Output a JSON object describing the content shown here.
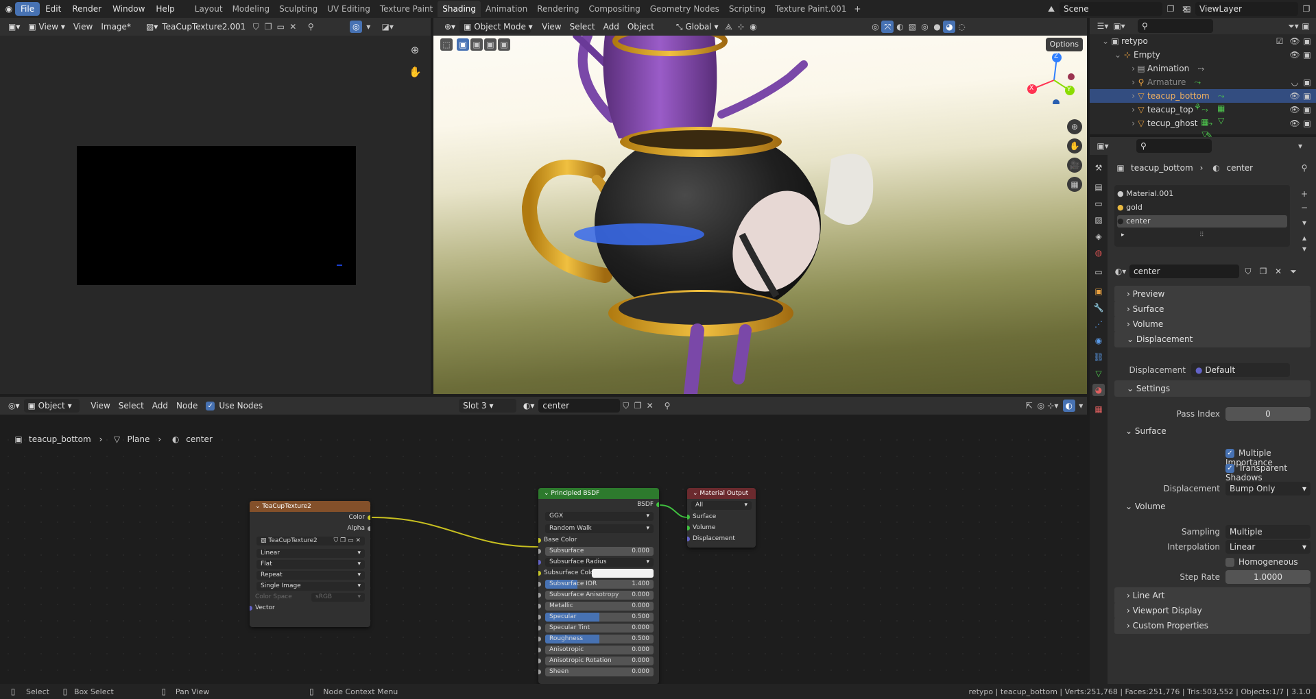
{
  "topbar": {
    "menus": [
      "File",
      "Edit",
      "Render",
      "Window",
      "Help"
    ],
    "workspaces": [
      "Layout",
      "Modeling",
      "Sculpting",
      "UV Editing",
      "Texture Paint",
      "Shading",
      "Animation",
      "Rendering",
      "Compositing",
      "Geometry Nodes",
      "Scripting",
      "Texture Paint.001"
    ],
    "active_workspace": "Shading",
    "scene": "Scene",
    "view_layer": "ViewLayer"
  },
  "image_editor": {
    "view": "View",
    "view2": "View",
    "image_menu": "Image*",
    "image_name": "TeaCupTexture2.001"
  },
  "viewport": {
    "mode": "Object Mode",
    "menus": [
      "View",
      "Select",
      "Add",
      "Object"
    ],
    "orientation": "Global",
    "options": "Options",
    "axes": {
      "x": "X",
      "y": "Y",
      "z": "Z"
    }
  },
  "node_header": {
    "editor": "Object",
    "menus": [
      "View",
      "Select",
      "Add",
      "Node"
    ],
    "use_nodes": "Use Nodes",
    "slot": "Slot 3",
    "material": "center"
  },
  "node_breadcrumb": {
    "object": "teacup_bottom",
    "mesh": "Plane",
    "material": "center"
  },
  "nodes": {
    "texture": {
      "title": "TeaCupTexture2",
      "out_color": "Color",
      "out_alpha": "Alpha",
      "image": "TeaCupTexture2",
      "interpolation": "Linear",
      "projection": "Flat",
      "extension": "Repeat",
      "source": "Single Image",
      "color_space_label": "Color Space",
      "color_space": "sRGB",
      "in_vector": "Vector"
    },
    "bsdf": {
      "title": "Principled BSDF",
      "out": "BSDF",
      "distribution": "GGX",
      "subsurface_method": "Random Walk",
      "base_color": "Base Color",
      "subsurface_radius": "Subsurface Radius",
      "subsurface_color": "Subsurface Colo",
      "rows": [
        {
          "label": "Subsurface",
          "value": "0.000",
          "fill": 0
        },
        {
          "label": "Subsurface IOR",
          "value": "1.400",
          "fill": 0.3
        },
        {
          "label": "Subsurface Anisotropy",
          "value": "0.000",
          "fill": 0
        },
        {
          "label": "Metallic",
          "value": "0.000",
          "fill": 0
        },
        {
          "label": "Specular",
          "value": "0.500",
          "fill": 0.5
        },
        {
          "label": "Specular Tint",
          "value": "0.000",
          "fill": 0
        },
        {
          "label": "Roughness",
          "value": "0.500",
          "fill": 0.5
        },
        {
          "label": "Anisotropic",
          "value": "0.000",
          "fill": 0
        },
        {
          "label": "Anisotropic Rotation",
          "value": "0.000",
          "fill": 0
        },
        {
          "label": "Sheen",
          "value": "0.000",
          "fill": 0
        }
      ]
    },
    "output": {
      "title": "Material Output",
      "target": "All",
      "surface": "Surface",
      "volume": "Volume",
      "displacement": "Displacement"
    }
  },
  "outliner": {
    "rows": [
      {
        "name": "retypo",
        "level": 0
      },
      {
        "name": "Empty",
        "level": 1
      },
      {
        "name": "Animation",
        "level": 2
      },
      {
        "name": "Armature",
        "level": 2
      },
      {
        "name": "teacup_bottom",
        "level": 2
      },
      {
        "name": "teacup_top",
        "level": 2
      },
      {
        "name": "tecup_ghost",
        "level": 2
      }
    ]
  },
  "properties": {
    "breadcrumb_object": "teacup_bottom",
    "breadcrumb_material": "center",
    "slots": [
      "Material.001",
      "gold",
      "center"
    ],
    "material_name": "center",
    "panels": {
      "preview": "Preview",
      "surface": "Surface",
      "volume": "Volume",
      "displacement": "Displacement",
      "settings": "Settings",
      "line_art": "Line Art",
      "viewport_display": "Viewport Display",
      "custom_properties": "Custom Properties"
    },
    "displacement_label": "Displacement",
    "displacement_value": "Default",
    "pass_index_label": "Pass Index",
    "pass_index": "0",
    "surface_sub": "Surface",
    "multiple_importance": "Multiple Importance",
    "transparent_shadows": "Transparent Shadows",
    "disp_method_label": "Displacement",
    "disp_method": "Bump Only",
    "volume_sub": "Volume",
    "sampling_label": "Sampling",
    "sampling": "Multiple Importance",
    "interp_label": "Interpolation",
    "interp": "Linear",
    "homogeneous": "Homogeneous",
    "step_rate_label": "Step Rate",
    "step_rate": "1.0000"
  },
  "statusbar": {
    "select": "Select",
    "box_select": "Box Select",
    "pan_view": "Pan View",
    "context_menu": "Node Context Menu",
    "stats": "retypo | teacup_bottom | Verts:251,768 | Faces:251,776 | Tris:503,552 | Objects:1/7 | 3.1.0"
  },
  "colors": {
    "accent": "#4772b3",
    "texture_node_header": "#83502a",
    "shader_node_header": "#2d7a2d",
    "output_node_header": "#6b2a2e",
    "link_yellow": "#c8c020",
    "link_green": "#40c040"
  }
}
